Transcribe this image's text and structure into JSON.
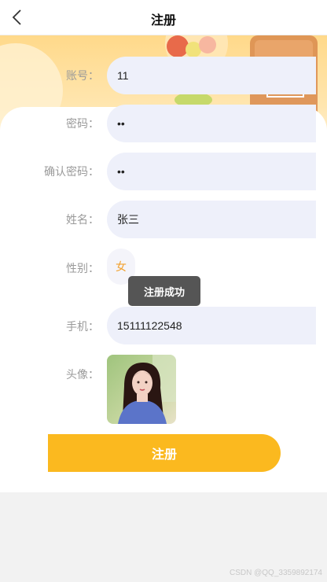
{
  "header": {
    "title": "注册",
    "back_icon": "back-arrow-icon"
  },
  "form": {
    "account": {
      "label": "账号：",
      "value": "11"
    },
    "password": {
      "label": "密码：",
      "value": "••"
    },
    "confirm_password": {
      "label": "确认密码：",
      "value": "••"
    },
    "name": {
      "label": "姓名：",
      "value": "张三"
    },
    "gender": {
      "label": "性别：",
      "value": "女"
    },
    "phone": {
      "label": "手机：",
      "value": "15111122548"
    },
    "avatar": {
      "label": "头像："
    }
  },
  "toast": {
    "text": "注册成功"
  },
  "submit": {
    "label": "注册"
  },
  "watermark": "CSDN @QQ_3359892174",
  "colors": {
    "accent": "#fbb91f",
    "input_bg": "#eef0fa",
    "gender_text": "#f2a12e",
    "toast_bg": "#555555"
  }
}
